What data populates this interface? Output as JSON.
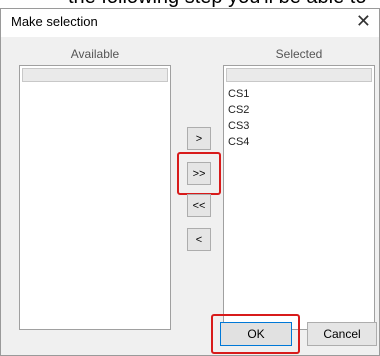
{
  "dialog": {
    "title": "Make selection",
    "close_glyph": "✕"
  },
  "available": {
    "caption": "Available",
    "items": []
  },
  "selected": {
    "caption": "Selected",
    "items": [
      "CS1",
      "CS2",
      "CS3",
      "CS4"
    ]
  },
  "transfer_buttons": {
    "add": ">",
    "add_all": ">>",
    "remove_all": "<<",
    "remove": "<"
  },
  "footer": {
    "ok_label": "OK",
    "cancel_label": "Cancel"
  },
  "highlight_color": "#d81b1b"
}
